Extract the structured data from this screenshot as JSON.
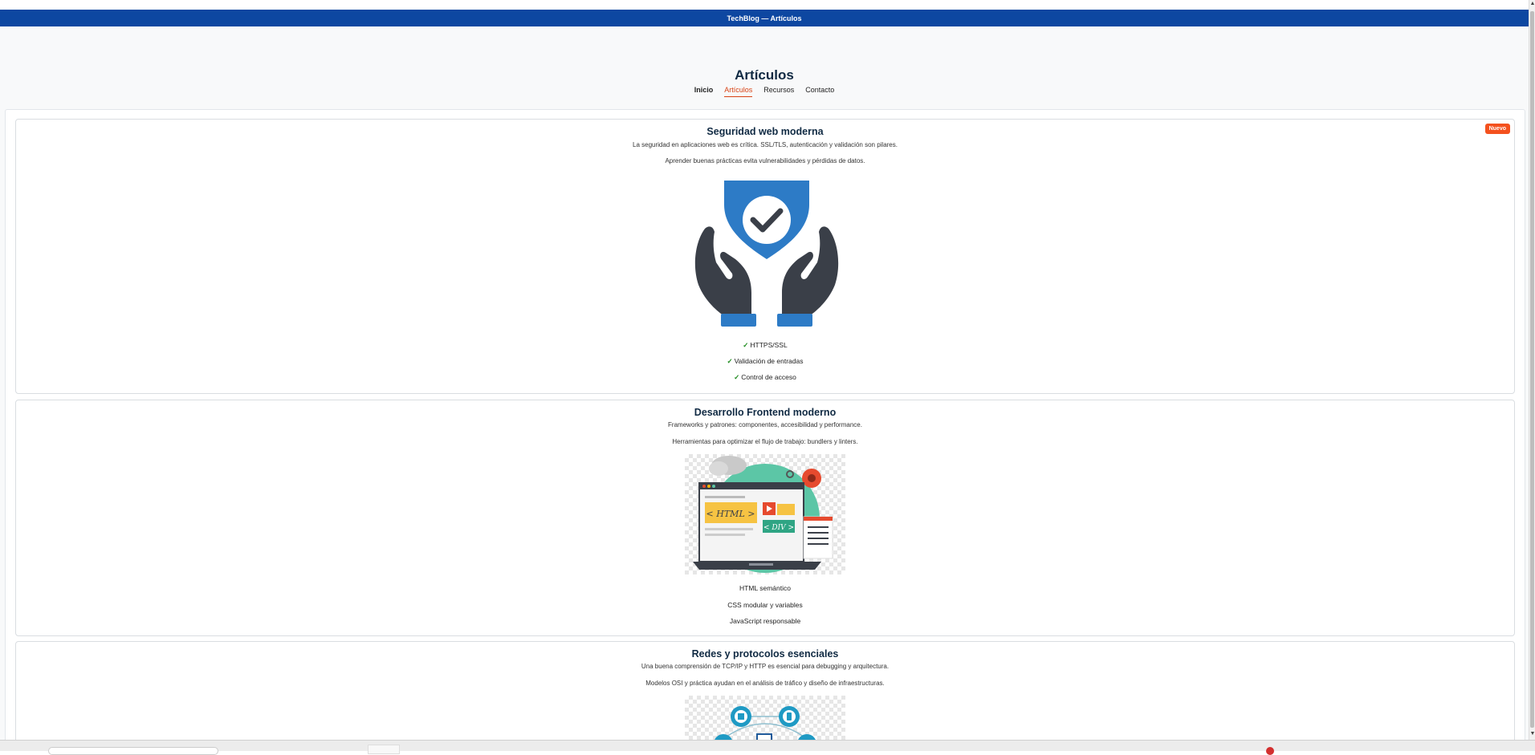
{
  "window": {
    "title": "TechBlog — Artículos"
  },
  "page": {
    "heading": "Artículos"
  },
  "nav": {
    "items": [
      {
        "label": "Inicio"
      },
      {
        "label": "Artículos"
      },
      {
        "label": "Recursos"
      },
      {
        "label": "Contacto"
      }
    ]
  },
  "cards": [
    {
      "badge": "Nuevo",
      "title": "Seguridad web moderna",
      "p1": "La seguridad en aplicaciones web es crítica. SSL/TLS, autenticación y validación son pilares.",
      "p2": "Aprender buenas prácticas evita vulnerabilidades y pérdidas de datos.",
      "image_icon": "shield-hands-icon",
      "items": [
        {
          "check": "✓",
          "label": "HTTPS/SSL"
        },
        {
          "check": "✓",
          "label": "Validación de entradas"
        },
        {
          "check": "✓",
          "label": "Control de acceso"
        }
      ]
    },
    {
      "title": "Desarrollo Frontend moderno",
      "p1": "Frameworks y patrones: componentes, accesibilidad y performance.",
      "p2": "Herramientas para optimizar el flujo de trabajo: bundlers y linters.",
      "image_icon": "laptop-web-dev-icon",
      "image_text": {
        "html": "< HTML >",
        "div": "< DIV >"
      },
      "items": [
        {
          "label": "HTML semántico"
        },
        {
          "label": "CSS modular y variables"
        },
        {
          "label": "JavaScript responsable"
        }
      ]
    },
    {
      "title": "Redes y protocolos esenciales",
      "p1": "Una buena comprensión de TCP/IP y HTTP es esencial para debugging y arquitectura.",
      "p2": "Modelos OSI y práctica ayudan en el análisis de tráfico y diseño de infraestructuras.",
      "image_icon": "network-nodes-icon"
    }
  ],
  "colors": {
    "titlebar": "#0d47a1",
    "accent": "#d84315",
    "badge": "#f4511e",
    "heading": "#102a43",
    "check": "#1b8a1b",
    "shield_blue": "#2d7bc6",
    "hands_dark": "#3a3f48"
  }
}
